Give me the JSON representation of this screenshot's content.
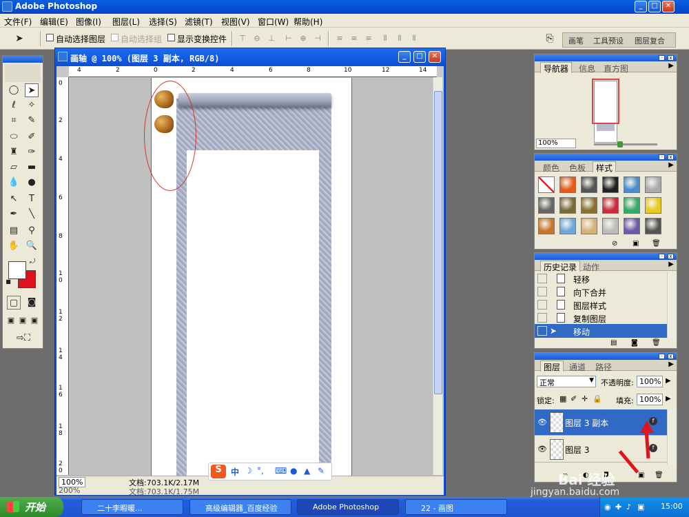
{
  "app": {
    "title": "Adobe Photoshop"
  },
  "menu": [
    "文件(F)",
    "编辑(E)",
    "图像(I)",
    "图层(L)",
    "选择(S)",
    "滤镜(T)",
    "视图(V)",
    "窗口(W)",
    "帮助(H)"
  ],
  "options": {
    "auto_select_layer": "自动选择图层",
    "auto_select_group": "自动选择组",
    "show_transform": "显示变换控件",
    "palette_well": [
      "画笔",
      "工具预设",
      "图层复合"
    ]
  },
  "document": {
    "title": "画轴 @ 100% (图层 3 副本, RGB/8)",
    "ruler_h": [
      "4",
      "2",
      "0",
      "2",
      "4",
      "6",
      "8",
      "10",
      "12",
      "14"
    ],
    "ruler_v": [
      "0",
      "2",
      "4",
      "6",
      "8",
      "1\n0",
      "1\n2",
      "1\n4",
      "1\n6",
      "1\n8",
      "2\n0"
    ],
    "zoom": "100%",
    "doc_size": "文档:703.1K/2.17M",
    "zoom_behind": "200%",
    "doc_size_behind": "文档:703.1K/1.75M"
  },
  "navigator": {
    "tabs": [
      "导航器",
      "信息",
      "直方图"
    ],
    "zoom": "100%"
  },
  "styles_panel": {
    "tabs": [
      "颜色",
      "色板",
      "样式"
    ],
    "swatches": [
      "#ffffff",
      "#e85a1a",
      "#555555",
      "#222222",
      "#4a8ccc",
      "#aaaaaa",
      "#666666",
      "#7a6a3a",
      "#8a7030",
      "#cc2a3a",
      "#33aa66",
      "#e8c81a",
      "#c8742a",
      "#6aa8dc",
      "#d8b07a",
      "#bbbbbb",
      "#6a5aa8",
      "#555555"
    ]
  },
  "history": {
    "tabs": [
      "历史记录",
      "动作"
    ],
    "items": [
      {
        "label": "轻移"
      },
      {
        "label": "向下合并"
      },
      {
        "label": "图层样式"
      },
      {
        "label": "复制图层"
      },
      {
        "label": "移动"
      }
    ]
  },
  "layers": {
    "tabs": [
      "图层",
      "通道",
      "路径"
    ],
    "blend_mode": "正常",
    "opacity_label": "不透明度:",
    "opacity": "100%",
    "lock_label": "锁定:",
    "fill_label": "填充:",
    "fill": "100%",
    "items": [
      {
        "name": "图层 3 副本"
      },
      {
        "name": "图层 3"
      }
    ]
  },
  "ime": {
    "logo": "S",
    "mode": "中"
  },
  "taskbar": {
    "start": "开始",
    "buttons": [
      "二十李暇暖...",
      "高级编辑器_百度经验",
      "Adobe Photoshop",
      "22 - 画图"
    ],
    "clock": "15:00"
  },
  "watermark": {
    "brand": "Bai 经验",
    "url": "jingyan.baidu.com"
  },
  "colors": {
    "accent": "#0a4fd6",
    "selection": "#316ac5",
    "annotation": "#d4332a"
  }
}
